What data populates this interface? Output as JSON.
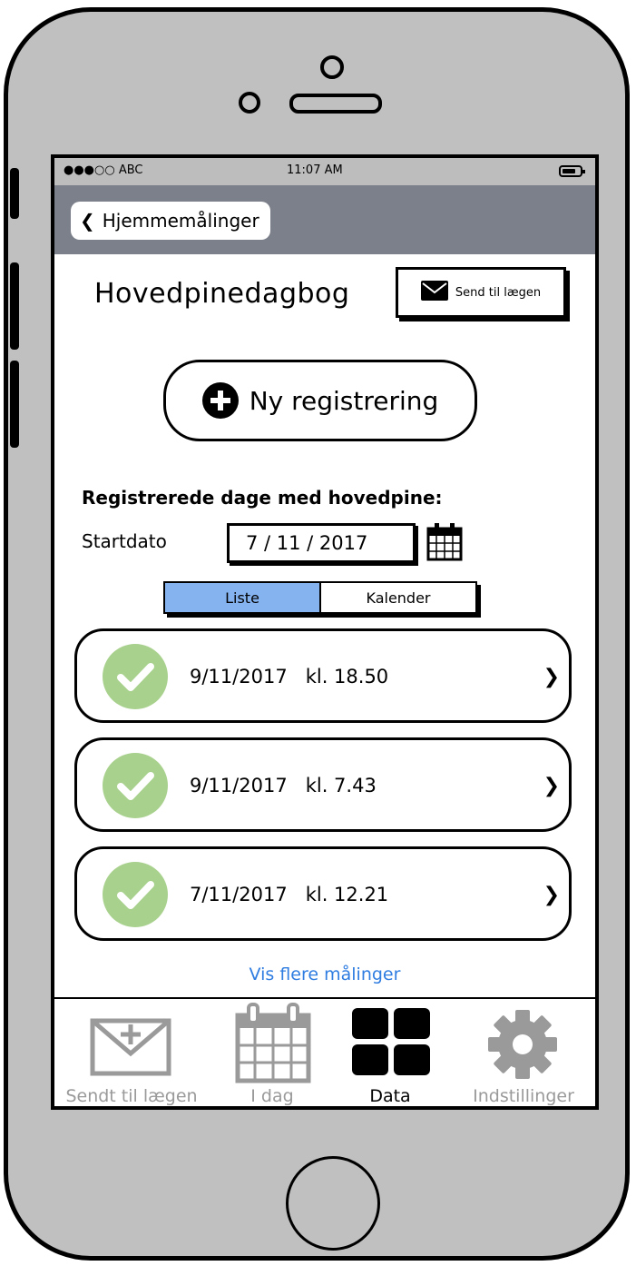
{
  "status_bar": {
    "carrier": "●●●○○ ABC",
    "time": "11:07 AM"
  },
  "nav": {
    "back_label": "Hjemmemålinger"
  },
  "header": {
    "title": "Hovedpinedagbog",
    "send_button": "Send til lægen"
  },
  "new_registration": {
    "label": "Ny registrering"
  },
  "registrations": {
    "heading": "Registrerede dage med hovedpine:",
    "start_label": "Startdato",
    "start_date": "7 / 11 / 2017",
    "segments": {
      "list": "Liste",
      "calendar": "Kalender",
      "selected": "Liste"
    },
    "items": [
      {
        "text": "9/11/2017   kl. 18.50"
      },
      {
        "text": "9/11/2017   kl. 7.43"
      },
      {
        "text": "7/11/2017   kl. 12.21"
      }
    ],
    "more_link": "Vis flere målinger"
  },
  "tabbar": {
    "tabs": [
      {
        "label": "Sendt til lægen",
        "icon": "envelope-plus-icon",
        "active": false
      },
      {
        "label": "I dag",
        "icon": "calendar-icon",
        "active": false
      },
      {
        "label": "Data",
        "icon": "grid-icon",
        "active": true
      },
      {
        "label": "Indstillinger",
        "icon": "gear-icon",
        "active": false
      }
    ]
  },
  "colors": {
    "navbar": "#7b808a",
    "status_bar": "#bdbdbd",
    "segment_active": "#85b3f0",
    "check_green": "#a9d18e",
    "link_blue": "#2f7de1",
    "phone_body": "#c0c0c0"
  }
}
